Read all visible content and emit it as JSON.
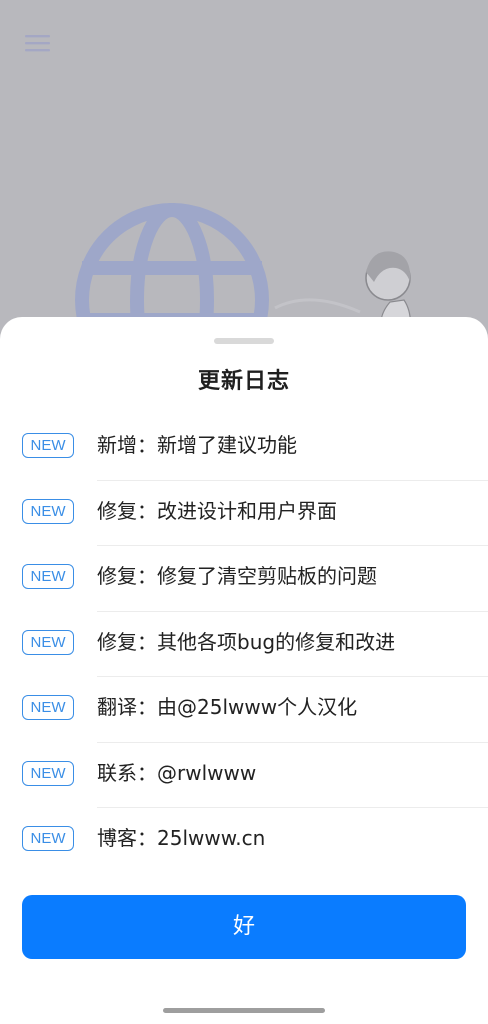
{
  "background": {
    "menu_icon": "hamburger-menu-icon",
    "illustration": "globe-and-person-illustration"
  },
  "dialog": {
    "title": "更新日志",
    "badge_label": "NEW",
    "items": [
      {
        "badge": "NEW",
        "text": "新增：新增了建议功能"
      },
      {
        "badge": "NEW",
        "text": "修复：改进设计和用户界面"
      },
      {
        "badge": "NEW",
        "text": "修复：修复了清空剪贴板的问题"
      },
      {
        "badge": "NEW",
        "text": "修复：其他各项bug的修复和改进"
      },
      {
        "badge": "NEW",
        "text": "翻译：由@25lwww个人汉化"
      },
      {
        "badge": "NEW",
        "text": "联系：@rwlwww"
      },
      {
        "badge": "NEW",
        "text": "博客：25lwww.cn"
      }
    ],
    "ok_label": "好"
  },
  "colors": {
    "accent": "#0a7cff",
    "badge": "#3a8ee6",
    "scrim_background": "#b8b8bd"
  }
}
